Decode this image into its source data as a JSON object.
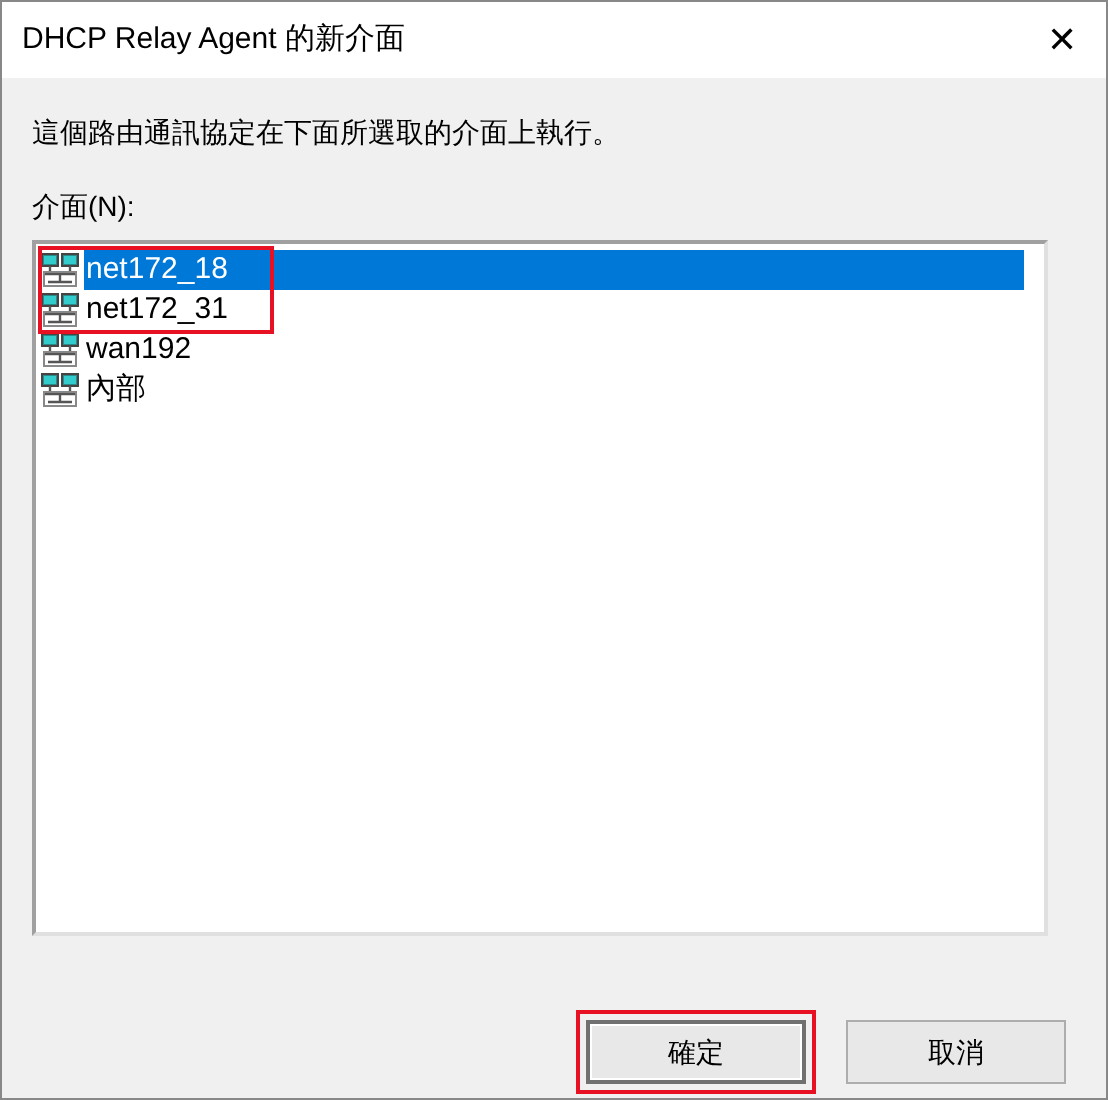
{
  "window": {
    "title": "DHCP Relay Agent 的新介面",
    "close": "✕"
  },
  "description": "這個路由通訊協定在下面所選取的介面上執行。",
  "list_label": "介面(N):",
  "interfaces": [
    {
      "name": "net172_18",
      "selected": true,
      "highlighted": true
    },
    {
      "name": "net172_31",
      "selected": false,
      "highlighted": true
    },
    {
      "name": "wan192",
      "selected": false,
      "highlighted": false
    },
    {
      "name": "內部",
      "selected": false,
      "highlighted": false
    }
  ],
  "buttons": [
    {
      "label": "確定",
      "default": true,
      "highlighted": true
    },
    {
      "label": "取消",
      "default": false,
      "highlighted": false
    }
  ]
}
